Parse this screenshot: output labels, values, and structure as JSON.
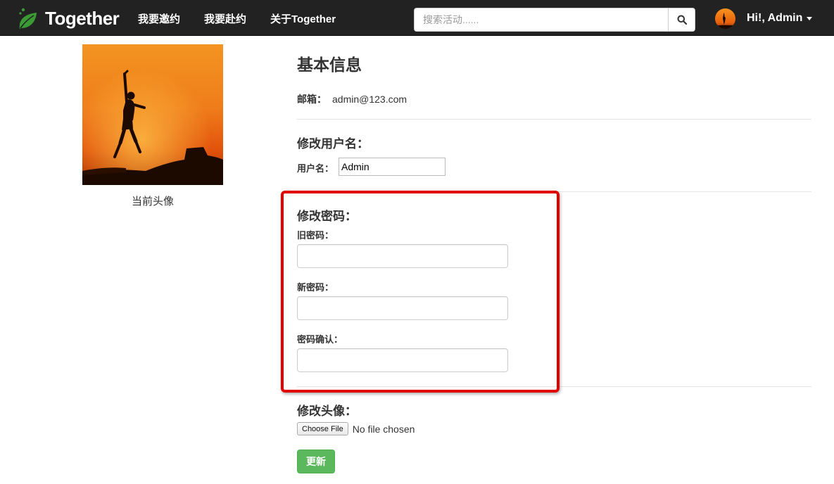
{
  "navbar": {
    "brand": "Together",
    "links": [
      "我要邀约",
      "我要赴约",
      "关于Together"
    ],
    "search_placeholder": "搜索活动......",
    "user_greeting": "Hi!, Admin"
  },
  "sidebar": {
    "avatar_caption": "当前头像"
  },
  "profile": {
    "title": "基本信息",
    "email_label": "邮箱：",
    "email_value": "admin@123.com",
    "username_section_title": "修改用户名：",
    "username_label": "用户名：",
    "username_value": "Admin",
    "password_section_title": "修改密码：",
    "old_password_label": "旧密码：",
    "new_password_label": "新密码：",
    "confirm_password_label": "密码确认：",
    "avatar_section_title": "修改头像：",
    "file_button_label": "Choose File",
    "file_status": "No file chosen",
    "submit_label": "更新"
  },
  "colors": {
    "navbar_bg": "#222222",
    "brand_green": "#3a9b35",
    "submit_green": "#5cb85c",
    "highlight_red": "#e00000"
  }
}
